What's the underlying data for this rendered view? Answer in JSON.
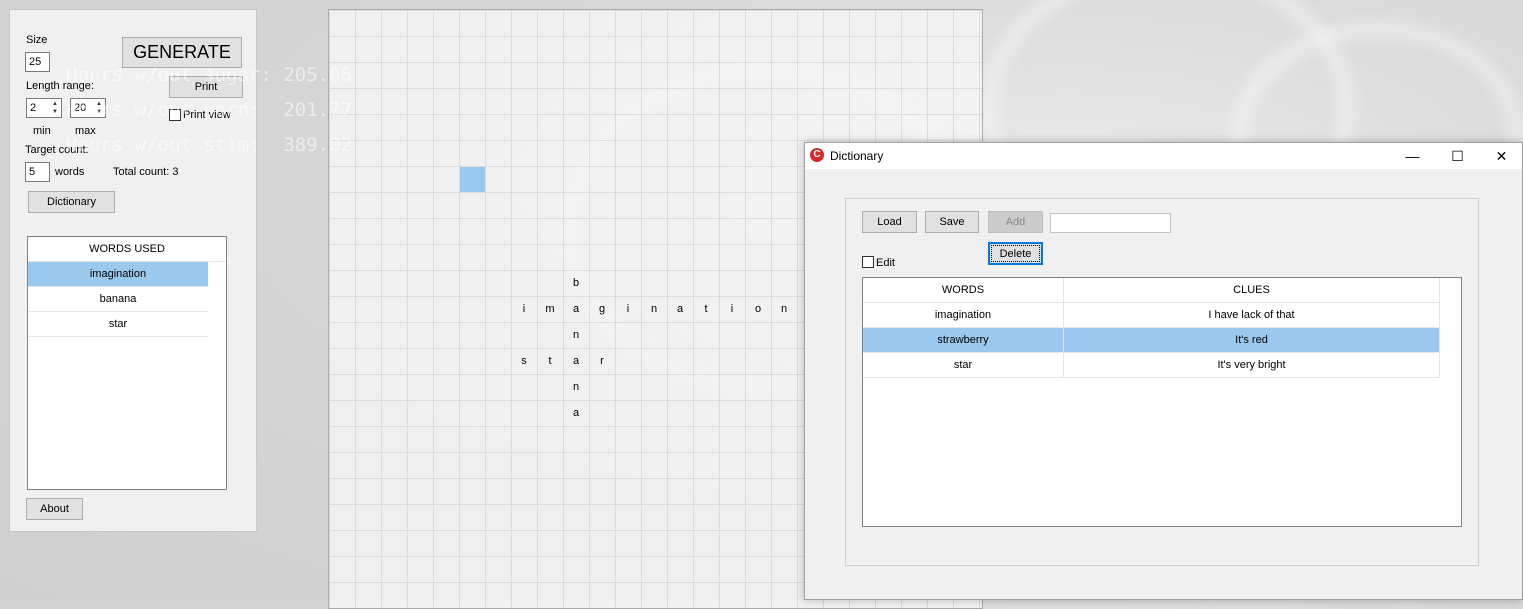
{
  "desktop_overlay": [
    "Hours w/out sugar: 205.06",
    "Hours w/out porn:  201.77",
    "Hours w/out stim:  389.02"
  ],
  "panel": {
    "size_label": "Size",
    "size_value": "25",
    "generate_label": "GENERATE",
    "print_label": "Print",
    "print_view_label": "Print view",
    "length_range_label": "Length range:",
    "min_value": "2",
    "max_value": "20",
    "min_label": "min",
    "max_label": "max",
    "target_count_label": "Target count:",
    "target_value": "5",
    "words_label": "words",
    "total_count_label": "Total count: 3",
    "dictionary_label": "Dictionary",
    "about_label": "About",
    "words_used_header": "WORDS USED",
    "words_used": [
      "imagination",
      "banana",
      "star"
    ],
    "selected_index": 0
  },
  "grid": {
    "size": 25,
    "words": [
      {
        "word": "imagination",
        "direction": "across",
        "row": 11,
        "col": 7
      },
      {
        "word": "banana",
        "direction": "down",
        "row": 10,
        "col": 9
      },
      {
        "word": "star",
        "direction": "across",
        "row": 13,
        "col": 7
      }
    ],
    "highlight_cell": {
      "row": 6,
      "col": 5
    },
    "highlight_color": "#99c9ef"
  },
  "dictionary": {
    "title": "Dictionary",
    "load_label": "Load",
    "save_label": "Save",
    "add_label": "Add",
    "delete_label": "Delete",
    "edit_label": "Edit",
    "word_input_value": "",
    "columns": [
      "WORDS",
      "CLUES"
    ],
    "rows": [
      {
        "word": "imagination",
        "clue": "I have lack of that"
      },
      {
        "word": "strawberry",
        "clue": "It's red"
      },
      {
        "word": "star",
        "clue": "It's very bright"
      }
    ],
    "selected_row": 1
  },
  "colors": {
    "selection": "#99c9ef",
    "app_icon": "#d9292b"
  }
}
